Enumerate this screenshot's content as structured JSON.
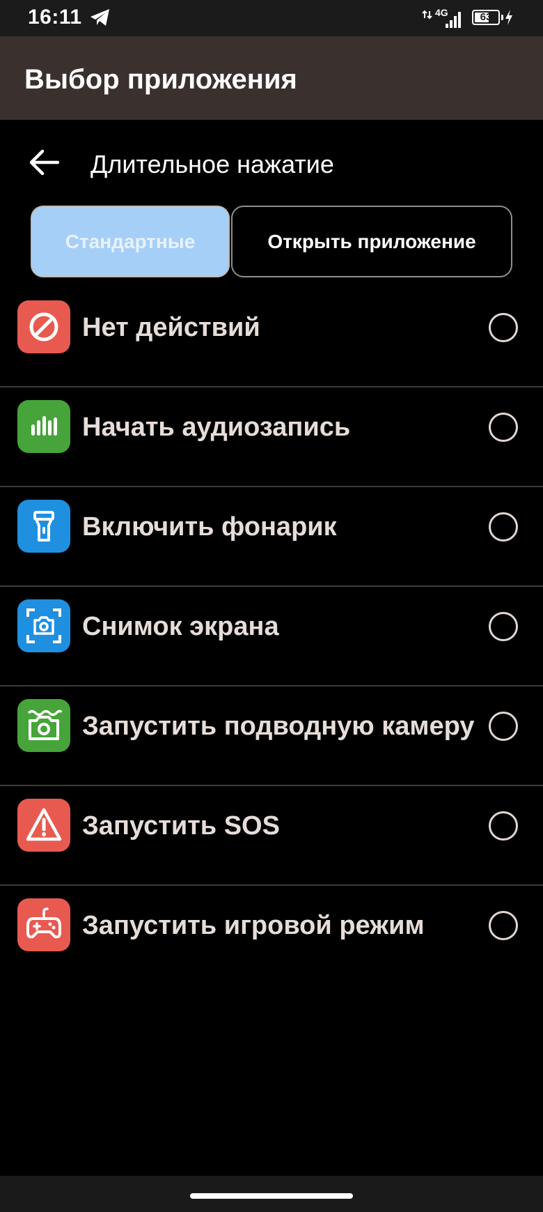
{
  "status_bar": {
    "time": "16:11",
    "network": "4G",
    "battery_percent": "63",
    "battery_level": 0.63
  },
  "app_bar": {
    "title": "Выбор приложения"
  },
  "header": {
    "title": "Длительное нажатие"
  },
  "tabs": [
    {
      "label": "Стандартные",
      "selected": true
    },
    {
      "label": "Открыть приложение",
      "selected": false
    }
  ],
  "actions": [
    {
      "label": "Нет действий",
      "icon": "no-action-icon",
      "color": "#e85a50"
    },
    {
      "label": "Начать аудиозапись",
      "icon": "audio-bars-icon",
      "color": "#46a43a"
    },
    {
      "label": "Включить фонарик",
      "icon": "flashlight-icon",
      "color": "#1f8fe0"
    },
    {
      "label": "Снимок экрана",
      "icon": "screenshot-camera-icon",
      "color": "#1f8fe0"
    },
    {
      "label": "Запустить подводную камеру",
      "icon": "underwater-camera-icon",
      "color": "#46a43a"
    },
    {
      "label": "Запустить SOS",
      "icon": "warning-icon",
      "color": "#e85a50"
    },
    {
      "label": "Запустить игровой режим",
      "icon": "gamepad-icon",
      "color": "#e85a50"
    }
  ]
}
